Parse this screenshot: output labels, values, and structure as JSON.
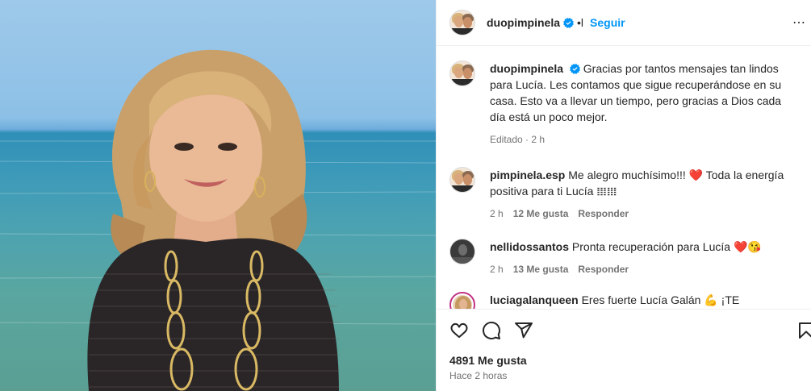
{
  "post": {
    "author": "duopimpinela",
    "header_dot": "•l",
    "follow_label": "Seguir",
    "caption_author": "duopimpinela",
    "caption": "Gracias por tantos mensajes tan lindos para Lucía. Les contamos que sigue recuperándose en su casa. Esto va a llevar un tiempo, pero gracias a Dios cada día está un poco mejor.",
    "caption_meta": "Editado · 2 h",
    "likes": "4891 Me gusta",
    "posted_ago": "Hace 2 horas"
  },
  "comments": [
    {
      "username": "pimpinela.esp",
      "text_before": " Me alegro muchísimo!!! ",
      "emoji1": "❤️",
      "text_after": " Toda la energía positiva para ti Lucía 𝍖𝍖",
      "time": "2 h",
      "likes": "12 Me gusta",
      "reply": "Responder"
    },
    {
      "username": "nellidossantos",
      "text_before": " Pronta recuperación para Lucía ",
      "emoji1": "❤️😘",
      "text_after": "",
      "time": "2 h",
      "likes": "13 Me gusta",
      "reply": "Responder"
    },
    {
      "username": "luciagalanqueen",
      "text_before": " Eres fuerte Lucía Galán 💪 ¡TE QUEREMOS! ",
      "emoji1": "❤️",
      "text_after": ""
    }
  ],
  "icons": {
    "like": "heart-outline-icon",
    "comment": "comment-bubble-icon",
    "share": "paper-plane-icon",
    "save": "bookmark-icon",
    "verified": "verified-badge-icon",
    "more": "more-options-icon"
  },
  "colors": {
    "link_blue": "#0095f6",
    "verified_blue": "#0095f6",
    "heart_red": "#e0245e",
    "muted": "#737373"
  }
}
